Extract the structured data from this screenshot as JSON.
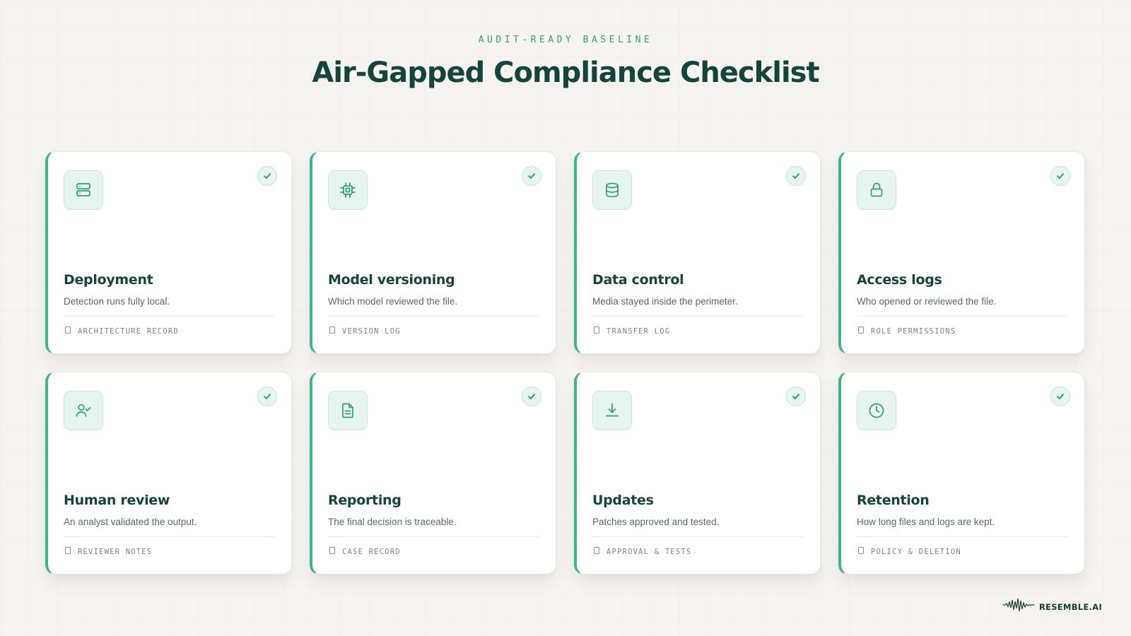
{
  "header": {
    "eyebrow": "AUDIT-READY BASELINE",
    "title": "Air-Gapped Compliance Checklist"
  },
  "colors": {
    "accent": "#3fb38a",
    "title": "#15443a",
    "icon_bg": "#e6f6ef"
  },
  "cards": [
    {
      "icon": "server-icon",
      "title": "Deployment",
      "description": "Detection runs fully local.",
      "tag": "ARCHITECTURE RECORD",
      "checked": true
    },
    {
      "icon": "cpu-chip-icon",
      "title": "Model versioning",
      "description": "Which model reviewed the file.",
      "tag": "VERSION LOG",
      "checked": true
    },
    {
      "icon": "database-icon",
      "title": "Data control",
      "description": "Media stayed inside the perimeter.",
      "tag": "TRANSFER LOG",
      "checked": true
    },
    {
      "icon": "lock-icon",
      "title": "Access logs",
      "description": "Who opened or reviewed the file.",
      "tag": "ROLE PERMISSIONS",
      "checked": true
    },
    {
      "icon": "user-check-icon",
      "title": "Human review",
      "description": "An analyst validated the output.",
      "tag": "REVIEWER NOTES",
      "checked": true
    },
    {
      "icon": "document-icon",
      "title": "Reporting",
      "description": "The final decision is traceable.",
      "tag": "CASE RECORD",
      "checked": true
    },
    {
      "icon": "download-icon",
      "title": "Updates",
      "description": "Patches approved and tested.",
      "tag": "APPROVAL & TESTS",
      "checked": true
    },
    {
      "icon": "clock-icon",
      "title": "Retention",
      "description": "How long files and logs are kept.",
      "tag": "POLICY & DELETION",
      "checked": true
    }
  ],
  "brand": {
    "name": "RESEMBLE.AI",
    "logo_icon": "waveform-icon"
  }
}
